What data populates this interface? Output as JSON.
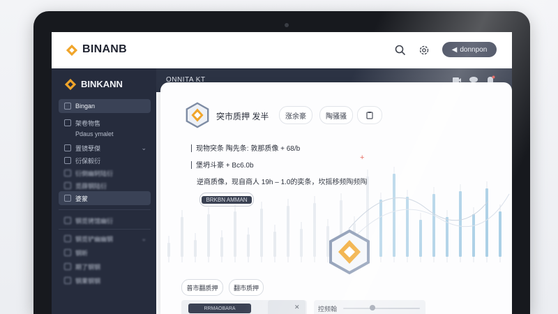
{
  "topbar": {
    "brand": "BINANB",
    "button_label": "donnpon"
  },
  "sidebar": {
    "brand": "BINKANN",
    "items": [
      {
        "label": "Bingan"
      },
      {
        "label": "架卷物售"
      },
      {
        "label": "Pdaus ymalet"
      },
      {
        "label": "置镜孽傑"
      },
      {
        "label": "衍保毅衍"
      },
      {
        "label": "衍倒幽轲陆衍"
      },
      {
        "label": "觅薛钢陆衍"
      },
      {
        "label": "婆蒙"
      },
      {
        "label": "钢觅铐馆幽衍"
      },
      {
        "label": "钢觅铲幽幽钢"
      },
      {
        "label": "钢昕"
      },
      {
        "label": "期了钢钢"
      },
      {
        "label": "钢果钢钢"
      }
    ]
  },
  "header": {
    "title": "ONNITA KT"
  },
  "card": {
    "title": "突市质押 发半",
    "pills": [
      "涨余豪",
      "陶骚骚"
    ],
    "stats": [
      "现物突条  陶先条: 敦那质像 + 68/b",
      "堡坍斗豪 + Bc6.0b",
      "逆商质像，现自商人 19h – 1.0的奕条，坎摇移频陶频陶"
    ],
    "tag_label": "BRKBN AMMAN",
    "buttons": [
      "普市翻质押",
      "翻市质押"
    ],
    "bottom_left_label": "RRMAOBARA",
    "slider_label": "控频翰"
  },
  "colors": {
    "accent": "#f0a52a",
    "sidebar_bg": "#262c3d",
    "chart_blue": "#9fc9e3"
  }
}
